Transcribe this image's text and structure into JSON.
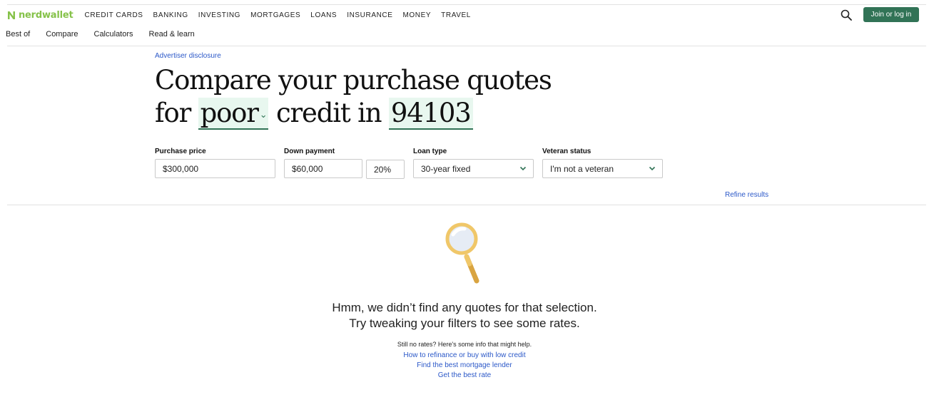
{
  "header": {
    "logo_text": "nerdwallet",
    "nav_items": [
      "CREDIT CARDS",
      "BANKING",
      "INVESTING",
      "MORTGAGES",
      "LOANS",
      "INSURANCE",
      "MONEY",
      "TRAVEL"
    ],
    "join_label": "Join or log in"
  },
  "subnav": [
    "Best of",
    "Compare",
    "Calculators",
    "Read & learn"
  ],
  "disclosure": "Advertiser disclosure",
  "headline": {
    "line1": "Compare your purchase quotes",
    "for": "for",
    "credit_value": "poor",
    "credit_in": "credit in",
    "zip": "94103"
  },
  "form": {
    "purchase_price": {
      "label": "Purchase price",
      "value": "$300,000"
    },
    "down_payment": {
      "label": "Down payment",
      "value": "$60,000",
      "percent": "20%"
    },
    "loan_type": {
      "label": "Loan type",
      "value": "30-year fixed"
    },
    "veteran_status": {
      "label": "Veteran status",
      "value": "I'm not a veteran"
    }
  },
  "refine_label": "Refine results",
  "empty": {
    "line1": "Hmm, we didn’t find any quotes for that selection.",
    "line2": "Try tweaking your filters to see some rates.",
    "help": "Still no rates? Here's some info that might help.",
    "links": [
      "How to refinance or buy with low credit",
      "Find the best mortgage lender",
      "Get the best rate"
    ]
  },
  "colors": {
    "brand_green": "#317356",
    "logo_green": "#86c24a",
    "link_blue": "#2b58c8",
    "highlight": "#e8f7ef"
  }
}
